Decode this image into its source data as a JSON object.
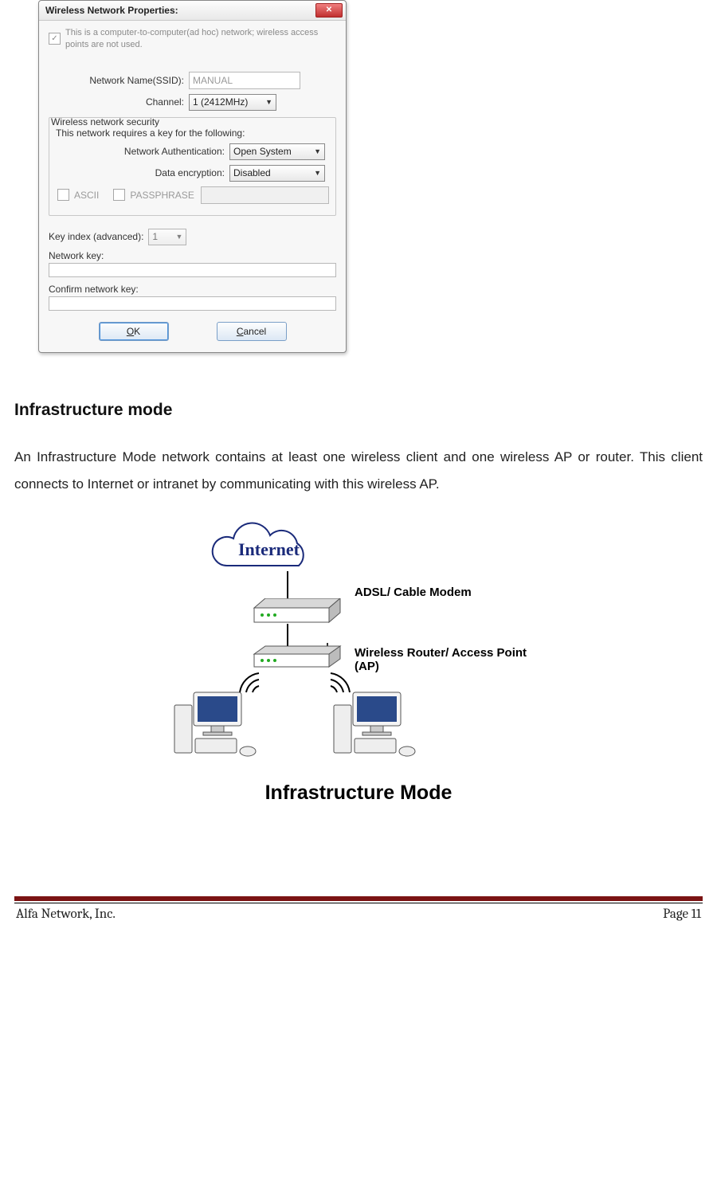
{
  "dialog": {
    "title": "Wireless Network Properties:",
    "adhoc_text": "This is a computer-to-computer(ad hoc) network; wireless access points are not used.",
    "ssid_label": "Network Name(SSID):",
    "ssid_value": "MANUAL",
    "channel_label": "Channel:",
    "channel_value": "1  (2412MHz)",
    "security": {
      "group_label": "Wireless network security",
      "requires_text": "This network requires a key for the following:",
      "auth_label": "Network Authentication:",
      "auth_value": "Open System",
      "enc_label": "Data encryption:",
      "enc_value": "Disabled",
      "ascii": "ASCII",
      "passphrase": "PASSPHRASE"
    },
    "keyindex_label": "Key index (advanced):",
    "keyindex_value": "1",
    "network_key_label": "Network key:",
    "confirm_key_label": "Confirm network key:",
    "ok_label": "OK",
    "cancel_label": "Cancel"
  },
  "doc": {
    "heading": "Infrastructure mode",
    "paragraph": "An Infrastructure Mode network contains at least one wireless client and one wireless AP or router. This client connects to Internet or intranet by communicating with this wireless AP."
  },
  "diagram": {
    "internet": "Internet",
    "modem": "ADSL/ Cable Modem",
    "router": "Wireless Router/ Access Point (AP)",
    "caption": "Infrastructure Mode"
  },
  "footer": {
    "company": "Alfa Network, Inc.",
    "page": "Page 11"
  }
}
